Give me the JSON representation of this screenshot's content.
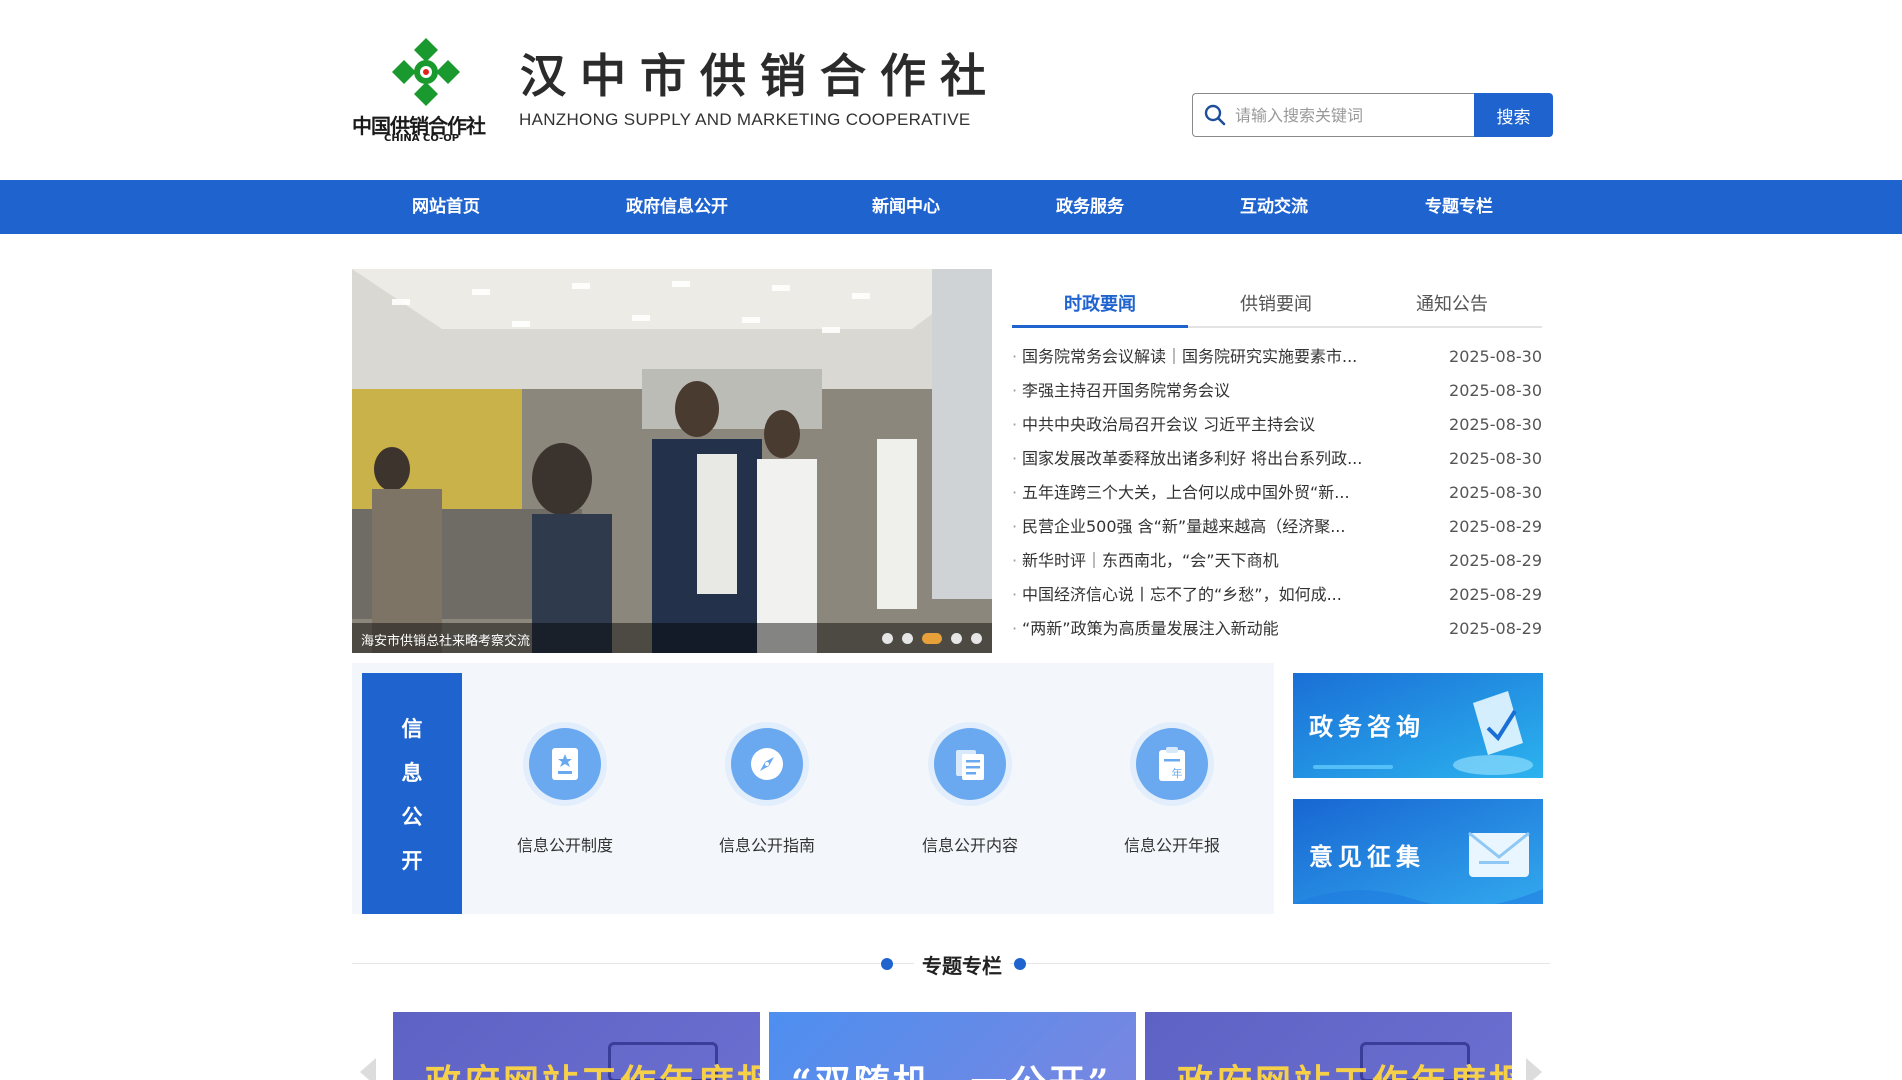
{
  "header": {
    "logo_text": "中国供销合作社",
    "logo_sub": "CHINA CO-OP",
    "title": "汉中市供销合作社",
    "subtitle": "HANZHONG SUPPLY AND MARKETING COOPERATIVE",
    "brand_color": "#1f63cf",
    "logo_color": "#1a9a2e"
  },
  "search": {
    "placeholder": "请输入搜索关键词",
    "button_label": "搜索",
    "icon": "search-icon"
  },
  "nav": {
    "items": [
      "网站首页",
      "政府信息公开",
      "新闻中心",
      "政务服务",
      "互动交流",
      "专题专栏"
    ]
  },
  "slider": {
    "caption": "海安市供销总社来略考察交流",
    "slide_count": 5,
    "active_index": 2
  },
  "news": {
    "tabs": [
      "时政要闻",
      "供销要闻",
      "通知公告"
    ],
    "active_tab": 0,
    "items": [
      {
        "title": "国务院常务会议解读｜国务院研究实施要素市...",
        "date": "2025-08-30"
      },
      {
        "title": "李强主持召开国务院常务会议",
        "date": "2025-08-30"
      },
      {
        "title": "中共中央政治局召开会议 习近平主持会议",
        "date": "2025-08-30"
      },
      {
        "title": "国家发展改革委释放出诸多利好 将出台系列政...",
        "date": "2025-08-30"
      },
      {
        "title": "五年连跨三个大关，上合何以成中国外贸“新...",
        "date": "2025-08-30"
      },
      {
        "title": "民营企业500强 含“新”量越来越高（经济聚...",
        "date": "2025-08-29"
      },
      {
        "title": "新华时评｜东西南北，“会”天下商机",
        "date": "2025-08-29"
      },
      {
        "title": "中国经济信心说丨忘不了的“乡愁”，如何成...",
        "date": "2025-08-29"
      },
      {
        "title": "“两新”政策为高质量发展注入新动能",
        "date": "2025-08-29"
      }
    ]
  },
  "info": {
    "side_chars": [
      "信",
      "息",
      "公",
      "开"
    ],
    "items": [
      {
        "label": "信息公开制度",
        "icon": "document-star-icon"
      },
      {
        "label": "信息公开指南",
        "icon": "compass-icon"
      },
      {
        "label": "信息公开内容",
        "icon": "documents-icon"
      },
      {
        "label": "信息公开年报",
        "icon": "annual-report-icon"
      }
    ]
  },
  "promos": {
    "consult": "政务咨询",
    "feedback": "意见征集"
  },
  "special": {
    "title": "专题专栏",
    "cards": [
      "政府网站工作年度报表",
      "“双随机、一公开”",
      "政府网站工作年度报表"
    ]
  }
}
